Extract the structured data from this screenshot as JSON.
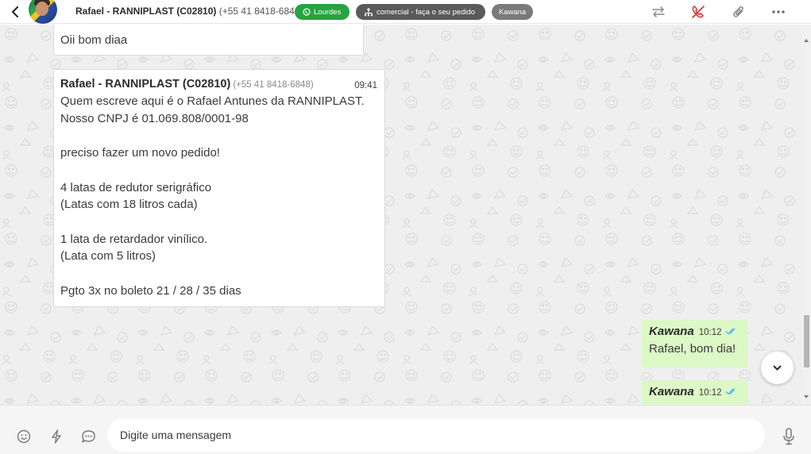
{
  "header": {
    "contact_name": "Rafael - RANNIPLAST (C02810)",
    "contact_phone": "(+55 41 8418-6848)",
    "tags": [
      {
        "label": "Lourdes",
        "color": "#25a43f",
        "icon": "whatsapp-icon"
      },
      {
        "label": "comercial - faça o seu pedido",
        "color": "#5a5a5a",
        "icon": "sitemap-icon"
      },
      {
        "label": "Kawana",
        "color": "#7a7a7a"
      }
    ],
    "actions": [
      "transfer-icon",
      "end-call-icon",
      "attachment-icon",
      "more-options-icon"
    ]
  },
  "messages": [
    {
      "direction": "in",
      "text": "Oii bom diaa"
    },
    {
      "direction": "in",
      "sender": "Rafael - RANNIPLAST (C02810)",
      "sender_phone": "(+55 41 8418-6848)",
      "time": "09:41",
      "body": "Quem escreve aqui é o Rafael Antunes da RANNIPLAST.\nNosso CNPJ é 01.069.808/0001-98\n\npreciso fazer um novo pedido!\n\n4 latas de redutor serigráfico\n(Latas com 18 litros cada)\n\n1 lata de retardador vinílico.\n(Lata com 5 litros)\n\nPgto 3x no boleto 21 / 28 / 35 dias"
    },
    {
      "direction": "out",
      "sender": "Kawana",
      "time": "10:12",
      "text": "Rafael, bom dia!",
      "status": "read"
    },
    {
      "direction": "out",
      "sender": "Kawana",
      "time": "10:12",
      "text": "",
      "status": "read"
    }
  ],
  "composer": {
    "placeholder": "Digite uma mensagem",
    "left_icons": [
      "emoji-icon",
      "quick-reply-icon",
      "chat-bubble-icon"
    ],
    "right_icon": "microphone-icon"
  },
  "colors": {
    "outgoing_bubble": "#dcf8c6",
    "read_ticks": "#4fb6ec",
    "chat_background": "#efefef"
  }
}
